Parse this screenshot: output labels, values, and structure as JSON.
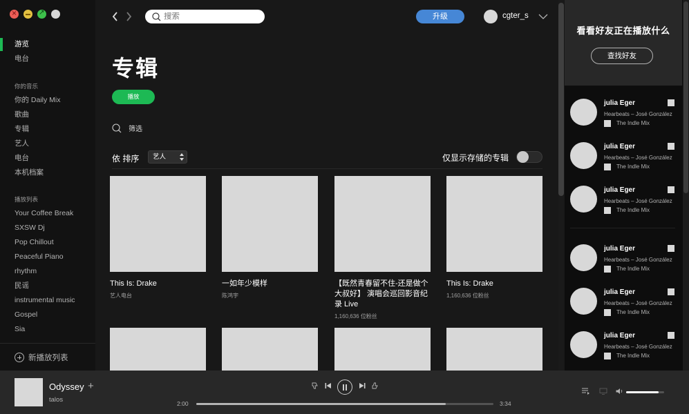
{
  "sidebar": {
    "main_items": [
      {
        "label": "游览",
        "active": true
      },
      {
        "label": "电台",
        "active": false
      }
    ],
    "your_music_heading": "你的音乐",
    "your_music_items": [
      "你的 Daily Mix",
      "歌曲",
      "专辑",
      "艺人",
      "电台",
      "本机档案"
    ],
    "playlists_heading": "播放列表",
    "playlists": [
      "Your Coffee Break",
      "SXSW Dj",
      "Pop Chillout",
      "Peaceful Piano",
      "rhythm",
      "民谣",
      "instrumental music",
      "Gospel",
      "Sia"
    ],
    "new_playlist_label": "新播放列表"
  },
  "topbar": {
    "search_placeholder": "搜索",
    "upgrade_label": "升级",
    "username": "cgter_s"
  },
  "main": {
    "title": "专辑",
    "play_label": "播放",
    "filter_label": "筛选",
    "sort_label": "依 排序",
    "sort_value": "艺人",
    "offline_label": "仅显示存储的专辑",
    "offline_enabled": false,
    "albums": [
      {
        "title": "This Is: Drake",
        "subtitle": "艺人电台"
      },
      {
        "title": "一如年少模样",
        "subtitle": "陈鸿宇"
      },
      {
        "title": "【既然青春留不住-还是做个大叔好】 演唱会巡回影音纪录 Live",
        "subtitle": "1,160,636 位粉丝"
      },
      {
        "title": "This Is: Drake",
        "subtitle": "1,160,636 位粉丝"
      },
      {
        "title": "",
        "subtitle": ""
      },
      {
        "title": "",
        "subtitle": ""
      },
      {
        "title": "",
        "subtitle": ""
      },
      {
        "title": "",
        "subtitle": ""
      }
    ]
  },
  "friends": {
    "title": "看看好友正在播放什么",
    "find_label": "查找好友",
    "items": [
      {
        "name": "julia Eger",
        "track": "Hearbeats – José González",
        "context": "The Indle Mix"
      },
      {
        "name": "julia Eger",
        "track": "Hearbeats – José González",
        "context": "The Indle Mix"
      },
      {
        "name": "julia Eger",
        "track": "Hearbeats – José González",
        "context": "The Indle Mix"
      },
      {
        "name": "julia Eger",
        "track": "Hearbeats – José González",
        "context": "The Indle Mix"
      },
      {
        "name": "julia Eger",
        "track": "Hearbeats – José González",
        "context": "The Indle Mix"
      },
      {
        "name": "julia Eger",
        "track": "Hearbeats – José González",
        "context": "The Indle Mix"
      }
    ]
  },
  "player": {
    "track_title": "Odyssey",
    "artist": "talos",
    "time_elapsed": "2:00",
    "time_total": "3:34",
    "progress_fraction": 0.84,
    "volume_fraction": 0.85
  },
  "colors": {
    "accent_green": "#1db954",
    "upgrade_blue": "#4687d6"
  }
}
